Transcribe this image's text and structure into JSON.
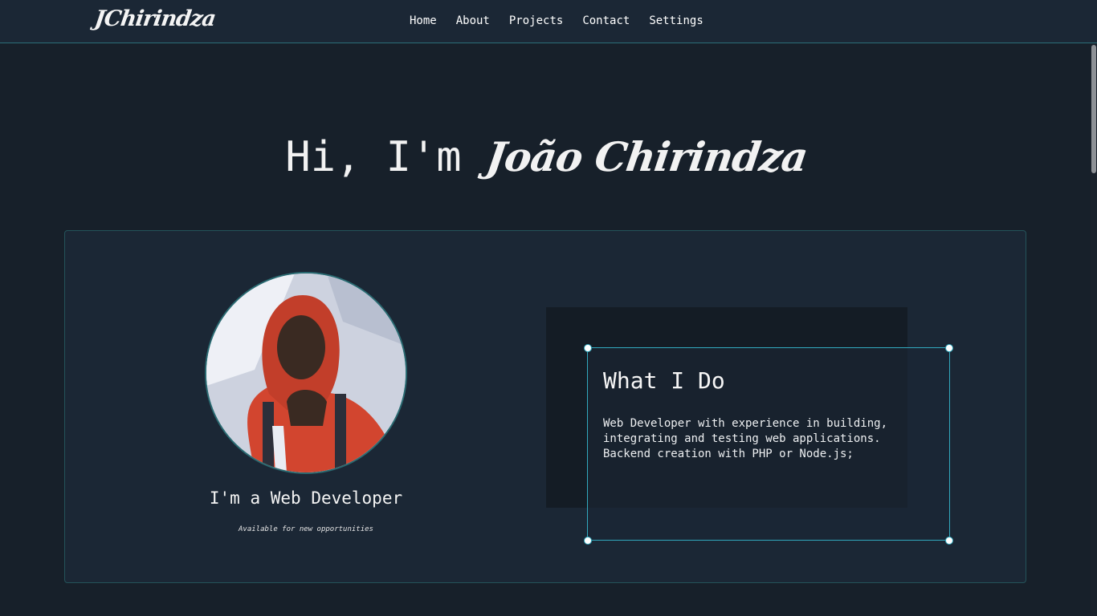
{
  "brand": {
    "logo_text": "JChirindza"
  },
  "nav": {
    "items": [
      {
        "label": "Home"
      },
      {
        "label": "About"
      },
      {
        "label": "Projects"
      },
      {
        "label": "Contact"
      },
      {
        "label": "Settings"
      }
    ]
  },
  "hero": {
    "greeting": "Hi, I'm",
    "name": "João Chirindza"
  },
  "profile": {
    "role": "I'm a Web Developer",
    "availability": "Available for new opportunities"
  },
  "about": {
    "title": "What I Do",
    "description": "Web Developer with experience in building,\nintegrating and testing web applications.\nBackend creation with PHP or Node.js;"
  },
  "colors": {
    "background": "#17202a",
    "navbar": "#1b2735",
    "accent": "#32a9be",
    "text": "#f1f3f5"
  }
}
